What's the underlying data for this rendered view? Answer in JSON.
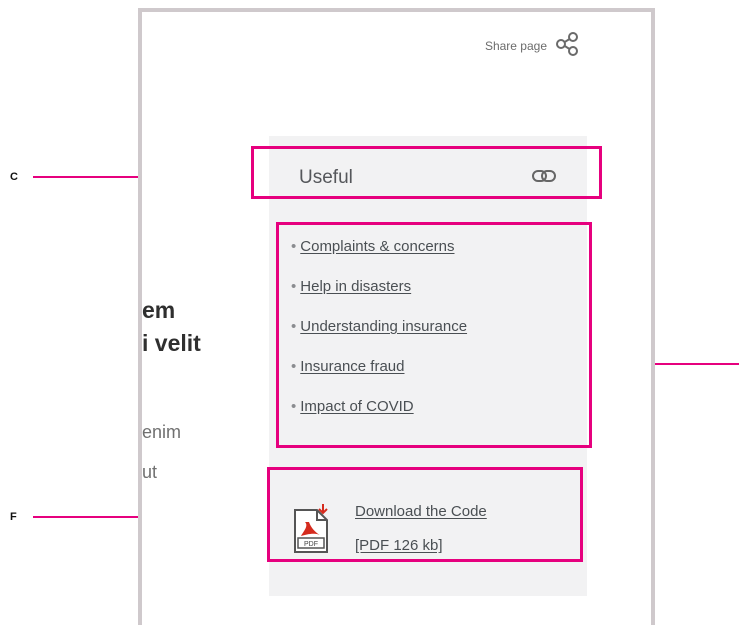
{
  "share": {
    "label": "Share page",
    "icon": "share-icon"
  },
  "article": {
    "heading_line1": "em",
    "heading_line2": "i velit",
    "para_line1": "enim",
    "para_line2": "ut"
  },
  "useful": {
    "title": "Useful",
    "title_icon": "link-icon",
    "links": [
      "Complaints & concerns",
      "Help in disasters",
      "Understanding insurance",
      "Insurance fraud",
      "Impact of COVID"
    ],
    "download": {
      "icon": "pdf-icon",
      "line1": "Download the Code",
      "line2": "[PDF 126 kb]"
    }
  },
  "callouts": {
    "c_label": "C",
    "f_label": "F"
  },
  "colors": {
    "highlight": "#e6007e",
    "frame": "#cfc9cc",
    "panel": "#f2f2f3"
  }
}
